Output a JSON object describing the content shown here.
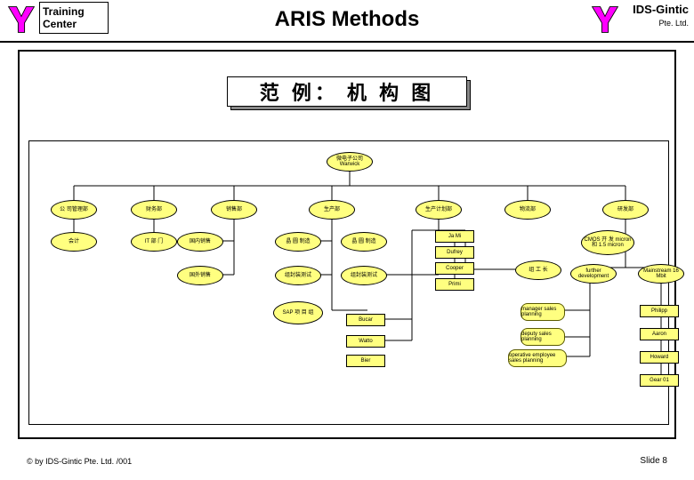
{
  "header": {
    "left_label_line1": "Training",
    "left_label_line2": "Center",
    "title": "ARIS Methods",
    "right_label": "IDS-Gintic",
    "right_sub": "Pte. Ltd."
  },
  "subtitle": "范 例： 机 构 图",
  "footer": "© by IDS-Gintic Pte. Ltd. /001",
  "slide": "Slide 8",
  "nodes": {
    "root": "微电子公司 Warwick",
    "d1": "公 司管理部",
    "d2": "财务部",
    "d3": "销售部",
    "d4": "生产部",
    "d5": "生产计划部",
    "d6": "物流部",
    "d7": "研发部",
    "l3_1": "会计",
    "l3_2": "IT 部 门",
    "l3_3": "国内销售",
    "l3_4": "晶 圆 制造",
    "l3_5": "国外销售",
    "l3_6": "组封装测试",
    "l3_7": "SAP 项 目 组",
    "r1": "Ja Mi",
    "r2": "Dufrey",
    "r3": "Cooper",
    "r4": "Primi",
    "r5": "Bucar",
    "r6": "Watto",
    "r7": "Bier",
    "extra1": "组 工 长",
    "rd1": "CMOS 开 发 micron 和 1.5 micron",
    "rd2": "further development",
    "rd3": "Mainstream 16 Mbit",
    "b1": "manager sales planning",
    "b2": "deputy sales planning",
    "b3": "operative employee sales planning",
    "p1": "Philipp",
    "p2": "Aaron",
    "p3": "Howard",
    "p4": "Gear 01"
  }
}
